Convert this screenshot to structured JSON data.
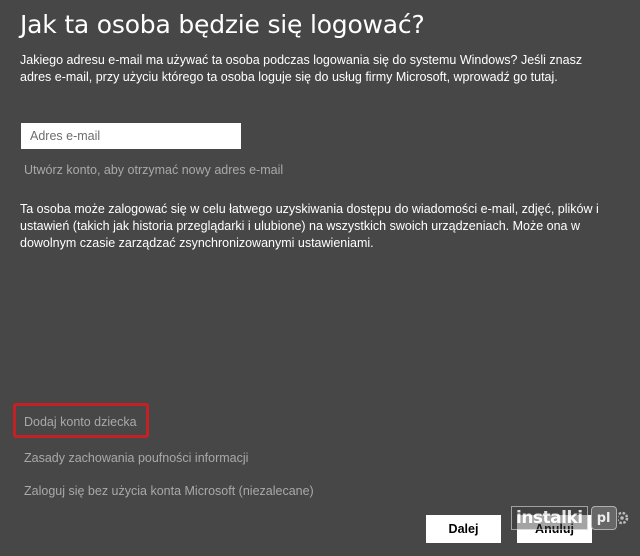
{
  "page": {
    "title": "Jak ta osoba będzie się logować?",
    "description": "Jakiego adresu e-mail ma używać ta osoba podczas logowania się do systemu Windows? Jeśli znasz adres e-mail, przy użyciu którego ta osoba loguje się do usług firmy Microsoft, wprowadź go tutaj.",
    "info": "Ta osoba może zalogować się w celu łatwego uzyskiwania dostępu do wiadomości e-mail, zdjęć, plików i ustawień (takich jak historia przeglądarki i ulubione) na wszystkich swoich urządzeniach. Może ona w dowolnym czasie zarządzać zsynchronizowanymi ustawieniami."
  },
  "email_field": {
    "placeholder": "Adres e-mail",
    "value": ""
  },
  "links": {
    "create_account": "Utwórz konto, aby otrzymać nowy adres e-mail",
    "add_child": "Dodaj konto dziecka",
    "privacy": "Zasady zachowania poufności informacji",
    "no_microsoft_account": "Zaloguj się bez użycia konta Microsoft (niezalecane)"
  },
  "buttons": {
    "next": "Dalej",
    "cancel": "Anuluj"
  },
  "watermark": {
    "text": "instalki",
    "badge": "pl",
    "icon": "gear-icon"
  },
  "colors": {
    "background": "#474747",
    "link": "#a9a9a9",
    "highlight": "#c42126"
  }
}
